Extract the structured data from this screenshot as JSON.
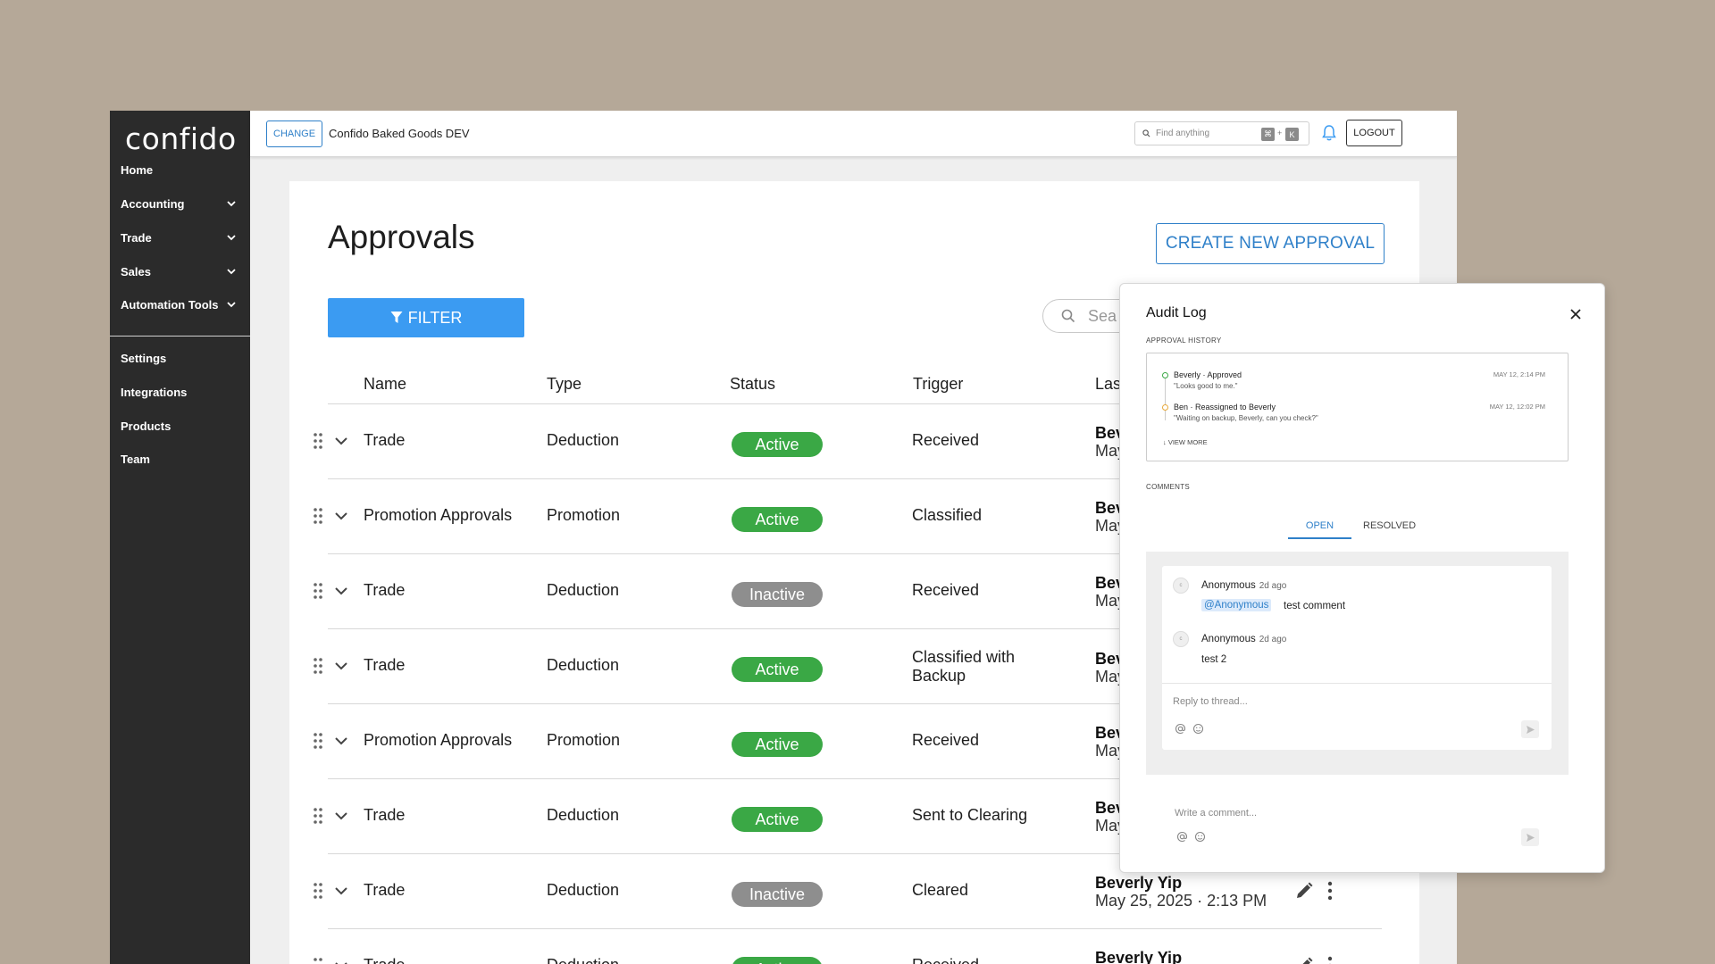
{
  "sidebar": {
    "logo": "confido",
    "items": [
      {
        "label": "Home"
      },
      {
        "label": "Accounting"
      },
      {
        "label": "Trade"
      },
      {
        "label": "Sales"
      },
      {
        "label": "Automation Tools"
      },
      {
        "label": "Settings"
      },
      {
        "label": "Integrations"
      },
      {
        "label": "Products"
      },
      {
        "label": "Team"
      }
    ]
  },
  "topbar": {
    "change_label": "CHANGE",
    "company": "Confido Baked Goods DEV",
    "search_placeholder": "Find anything",
    "kbd1": "⌘",
    "plus": "+",
    "kbd2": "K",
    "logout_label": "LOGOUT"
  },
  "page": {
    "title": "Approvals",
    "create_label": "CREATE NEW APPROVAL",
    "filter_label": "FILTER",
    "search_placeholder": "Sea",
    "columns": [
      "Name",
      "Type",
      "Status",
      "Trigger",
      "Las"
    ]
  },
  "rows": [
    {
      "name": "Trade",
      "type": "Deduction",
      "status": "Active",
      "trigger": "Received",
      "last_name": "Bev",
      "last_date": "May"
    },
    {
      "name": "Promotion Approvals",
      "type": "Promotion",
      "status": "Active",
      "trigger": "Classified",
      "last_name": "Bev",
      "last_date": "May"
    },
    {
      "name": "Trade",
      "type": "Deduction",
      "status": "Inactive",
      "trigger": "Received",
      "last_name": "Bev",
      "last_date": "May"
    },
    {
      "name": "Trade",
      "type": "Deduction",
      "status": "Active",
      "trigger": "Classified with",
      "trigger2": "Backup",
      "last_name": "Bev",
      "last_date": "May"
    },
    {
      "name": "Promotion Approvals",
      "type": "Promotion",
      "status": "Active",
      "trigger": "Received",
      "last_name": "Bev",
      "last_date": "May"
    },
    {
      "name": "Trade",
      "type": "Deduction",
      "status": "Active",
      "trigger": "Sent to Clearing",
      "last_name": "Bev",
      "last_date": "May"
    },
    {
      "name": "Trade",
      "type": "Deduction",
      "status": "Inactive",
      "trigger": "Cleared",
      "last_name": "Beverly Yip",
      "last_date": "May 25, 2025 · 2:13 PM"
    },
    {
      "name": "Trade",
      "type": "Deduction",
      "status": "Active",
      "trigger": "Received",
      "last_name": "Beverly Yip",
      "last_date": ""
    }
  ],
  "colors": {
    "active": "#3aa845",
    "inactive": "#8e8e8e",
    "accent": "#2f80c9",
    "filter": "#3b9bf2"
  },
  "audit": {
    "title": "Audit Log",
    "history_label": "APPROVAL HISTORY",
    "history": [
      {
        "title": "Beverly · Approved",
        "quote": "\"Looks good to me.\"",
        "time": "MAY 12, 2:14 PM"
      },
      {
        "title": "Ben · Reassigned to Beverly",
        "quote": "\"Waiting on backup, Beverly, can you check?\"",
        "time": "MAY 12, 12:02 PM"
      }
    ],
    "view_more": "VIEW MORE",
    "comments_label": "COMMENTS",
    "tab_open": "OPEN",
    "tab_resolved": "RESOLVED",
    "comments": [
      {
        "avatar": "c",
        "author": "Anonymous",
        "time": "2d ago",
        "mention": "@Anonymous",
        "text": "test comment"
      },
      {
        "avatar": "c",
        "author": "Anonymous",
        "time": "2d ago",
        "mention": "",
        "text": "test 2"
      }
    ],
    "reply_placeholder": "Reply to thread...",
    "write_placeholder": "Write a comment..."
  }
}
